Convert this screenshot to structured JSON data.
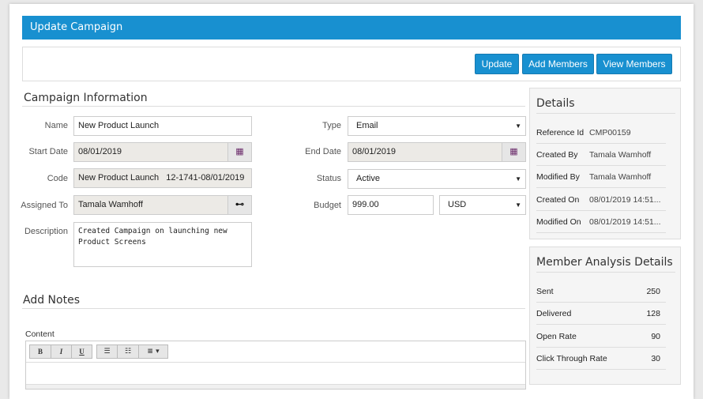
{
  "header": {
    "title": "Update Campaign"
  },
  "toolbar": {
    "update": "Update",
    "add_members": "Add Members",
    "view_members": "View Members"
  },
  "campaign_info": {
    "title": "Campaign Information",
    "name": {
      "label": "Name",
      "value": "New Product Launch"
    },
    "start_date": {
      "label": "Start Date",
      "value": "08/01/2019"
    },
    "code": {
      "label": "Code",
      "value": "New Product Launch   12-1741-08/01/2019"
    },
    "assigned_to": {
      "label": "Assigned To",
      "value": "Tamala Wamhoff"
    },
    "description": {
      "label": "Description",
      "value": "Created Campaign on launching new Product Screens"
    },
    "type": {
      "label": "Type",
      "value": "Email"
    },
    "end_date": {
      "label": "End Date",
      "value": "08/01/2019"
    },
    "status": {
      "label": "Status",
      "value": "Active"
    },
    "budget": {
      "label": "Budget",
      "value": "999.00",
      "currency": "USD"
    }
  },
  "details": {
    "title": "Details",
    "rows": [
      {
        "label": "Reference Id",
        "value": "CMP00159"
      },
      {
        "label": "Created By",
        "value": "Tamala Wamhoff"
      },
      {
        "label": "Modified By",
        "value": "Tamala Wamhoff"
      },
      {
        "label": "Created On",
        "value": "08/01/2019 14:51..."
      },
      {
        "label": "Modified On",
        "value": "08/01/2019 14:51..."
      }
    ]
  },
  "member_analysis": {
    "title": "Member Analysis Details",
    "rows": [
      {
        "label": "Sent",
        "value": "250"
      },
      {
        "label": "Delivered",
        "value": "128"
      },
      {
        "label": "Open Rate",
        "value": "90"
      },
      {
        "label": "Click Through Rate",
        "value": "30"
      }
    ]
  },
  "notes": {
    "title": "Add Notes",
    "content_label": "Content",
    "editor": {
      "bold": "B",
      "italic": "I",
      "underline": "U"
    }
  },
  "colors": {
    "accent": "#1890d0"
  }
}
